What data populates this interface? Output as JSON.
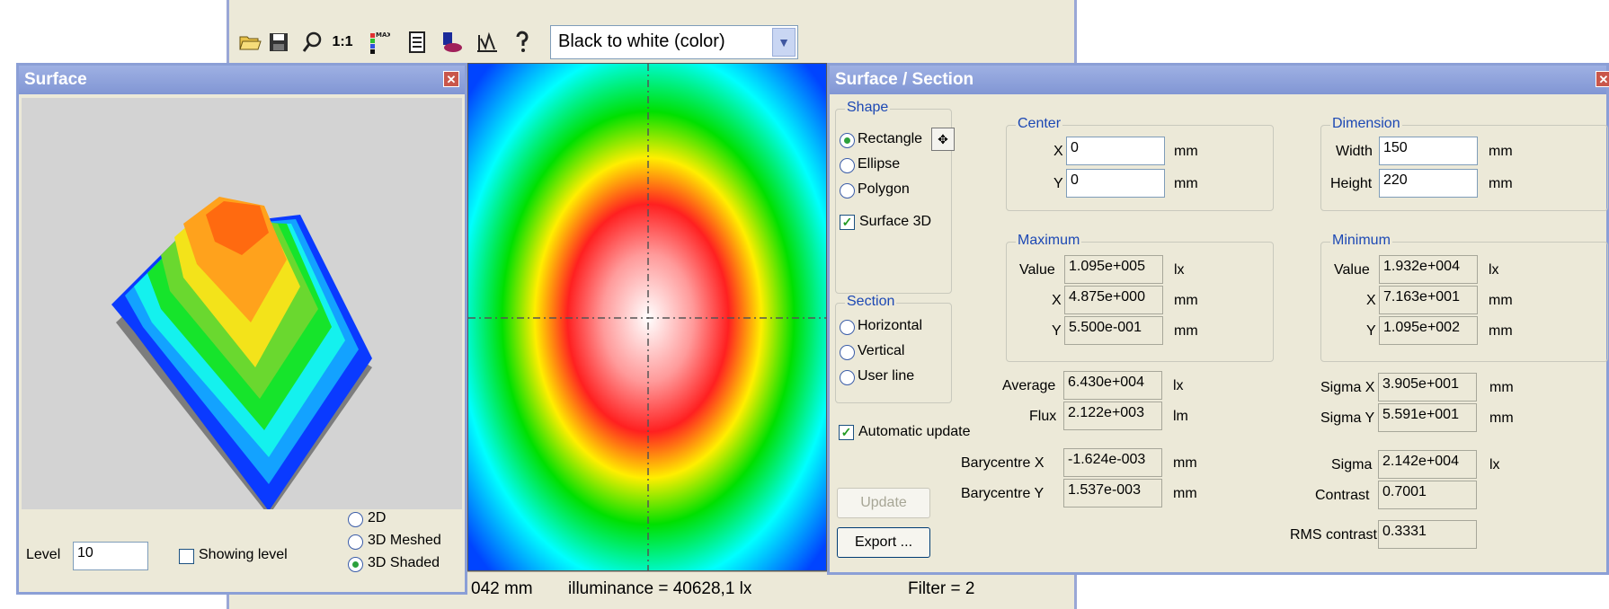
{
  "toolbar": {
    "icons": [
      "open-folder-icon",
      "save-icon",
      "zoom-icon",
      "one-to-one-icon",
      "color-scale-icon",
      "report-icon",
      "layer-icon",
      "graph-icon",
      "help-icon"
    ],
    "zoom_label": "1:1",
    "palette_value": "Black to white (color)"
  },
  "surface_window": {
    "title": "Surface",
    "level_label": "Level",
    "level_value": "10",
    "showing_level_label": "Showing level",
    "showing_level_checked": false,
    "modes": [
      "2D",
      "3D Meshed",
      "3D Shaded"
    ],
    "selected_mode": "3D Shaded"
  },
  "heatmap": {
    "colors": [
      "#ffffff",
      "#ff2020",
      "#ffff00",
      "#00e000",
      "#00ffff",
      "#0044ff"
    ]
  },
  "status": {
    "position": "042 mm",
    "illuminance": "illuminance = 40628,1 lx",
    "filter": "Filter = 2"
  },
  "section_window": {
    "title": "Surface / Section",
    "shape_group": "Shape",
    "shapes": [
      "Rectangle",
      "Ellipse",
      "Polygon"
    ],
    "selected_shape": "Rectangle",
    "surface3d_label": "Surface 3D",
    "surface3d_checked": true,
    "section_group": "Section",
    "sections": [
      "Horizontal",
      "Vertical",
      "User line"
    ],
    "auto_update_label": "Automatic update",
    "auto_update_checked": true,
    "update_button": "Update",
    "export_button": "Export ...",
    "center": {
      "title": "Center",
      "x_label": "X",
      "x": "0",
      "y_label": "Y",
      "y": "0",
      "unit": "mm"
    },
    "dimension": {
      "title": "Dimension",
      "width_label": "Width",
      "width": "150",
      "height_label": "Height",
      "height": "220",
      "unit": "mm"
    },
    "maximum": {
      "title": "Maximum",
      "value_label": "Value",
      "value": "1.095e+005",
      "value_unit": "lx",
      "x_label": "X",
      "x": "4.875e+000",
      "y_label": "Y",
      "y": "5.500e-001",
      "unit": "mm"
    },
    "minimum": {
      "title": "Minimum",
      "value_label": "Value",
      "value": "1.932e+004",
      "value_unit": "lx",
      "x_label": "X",
      "x": "7.163e+001",
      "y_label": "Y",
      "y": "1.095e+002",
      "unit": "mm"
    },
    "stats": {
      "average_label": "Average",
      "average": "6.430e+004",
      "average_unit": "lx",
      "flux_label": "Flux",
      "flux": "2.122e+003",
      "flux_unit": "lm",
      "bary_x_label": "Barycentre X",
      "bary_x": "-1.624e-003",
      "bary_x_unit": "mm",
      "bary_y_label": "Barycentre Y",
      "bary_y": "1.537e-003",
      "bary_y_unit": "mm",
      "sigma_x_label": "Sigma X",
      "sigma_x": "3.905e+001",
      "sigma_x_unit": "mm",
      "sigma_y_label": "Sigma Y",
      "sigma_y": "5.591e+001",
      "sigma_y_unit": "mm",
      "sigma_label": "Sigma",
      "sigma": "2.142e+004",
      "sigma_unit": "lx",
      "contrast_label": "Contrast",
      "contrast": "0.7001",
      "rms_label": "RMS contrast",
      "rms": "0.3331"
    }
  }
}
